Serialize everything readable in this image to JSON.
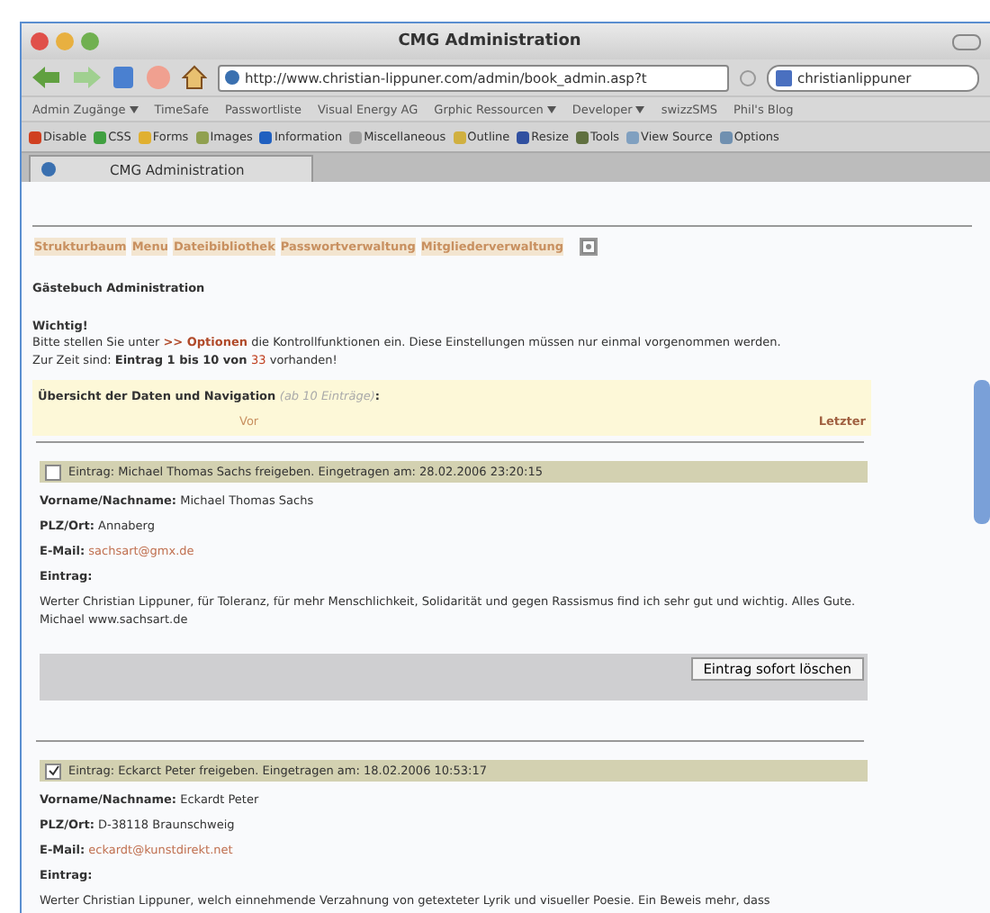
{
  "window": {
    "title": "CMG Administration"
  },
  "toolbar": {
    "url": "http://www.christian-lippuner.com/admin/book_admin.asp?t",
    "search": "christianlippuner"
  },
  "bookmarks": [
    {
      "label": "Admin Zugänge",
      "dropdown": true
    },
    {
      "label": "TimeSafe",
      "dropdown": false
    },
    {
      "label": "Passwortliste",
      "dropdown": false
    },
    {
      "label": "Visual Energy AG",
      "dropdown": false
    },
    {
      "label": "Grphic Ressourcen",
      "dropdown": true
    },
    {
      "label": "Developer",
      "dropdown": true
    },
    {
      "label": "swizzSMS",
      "dropdown": false
    },
    {
      "label": "Phil's Blog",
      "dropdown": false
    }
  ],
  "dev_toolbar": [
    {
      "label": "Disable",
      "color": "#d04020"
    },
    {
      "label": "CSS",
      "color": "#40a040"
    },
    {
      "label": "Forms",
      "color": "#e0b030"
    },
    {
      "label": "Images",
      "color": "#90a050"
    },
    {
      "label": "Information",
      "color": "#2060c0"
    },
    {
      "label": "Miscellaneous",
      "color": "#a0a0a0"
    },
    {
      "label": "Outline",
      "color": "#d0b040"
    },
    {
      "label": "Resize",
      "color": "#3050a0"
    },
    {
      "label": "Tools",
      "color": "#607040"
    },
    {
      "label": "View Source",
      "color": "#80a0c0"
    },
    {
      "label": "Options",
      "color": "#7090b0"
    }
  ],
  "tab": {
    "title": "CMG Administration"
  },
  "nav_links": [
    "Strukturbaum",
    "Menu",
    "Dateibibliothek",
    "Passwortverwaltung",
    "Mitgliederverwaltung"
  ],
  "heading": "Gästebuch Administration",
  "important": "Wichtig!",
  "notice": [
    [
      {
        "kind": "plain",
        "text": "Bitte stellen Sie unter "
      },
      {
        "kind": "link",
        "text": ">> Optionen"
      },
      {
        "kind": "plain",
        "text": " die Kontrollfunktionen ein. Diese Einstellungen müssen nur einmal vorgenommen werden."
      }
    ],
    [
      {
        "kind": "plain",
        "text": "Zur Zeit sind: "
      },
      {
        "kind": "bold",
        "text": "Eintrag 1 bis 10 von "
      },
      {
        "kind": "count",
        "text": "33"
      },
      {
        "kind": "plain",
        "text": " vorhanden!"
      }
    ]
  ],
  "overview": {
    "title": "Übersicht der Daten und Navigation",
    "hint": "(ab 10 Einträge)",
    "colon": ":",
    "prev": "Vor",
    "last": "Letzter"
  },
  "entries": [
    {
      "checked": false,
      "header": "Eintrag: Michael Thomas Sachs freigeben. Eingetragen am: 28.02.2006 23:20:15",
      "fields": [
        {
          "label": "Vorname/Nachname:",
          "value": "Michael Thomas Sachs",
          "kind": "text"
        },
        {
          "label": "PLZ/Ort:",
          "value": "Annaberg",
          "kind": "text"
        },
        {
          "label": "E-Mail:",
          "value": "sachsart@gmx.de",
          "kind": "email"
        }
      ],
      "message_label": "Eintrag:",
      "message": "Werter Christian Lippuner, für Toleranz, für mehr Menschlichkeit, Solidarität und gegen Rassismus find ich sehr gut und wichtig. Alles Gute. Michael www.sachsart.de",
      "delete": "Eintrag sofort löschen"
    },
    {
      "checked": true,
      "header": "Eintrag: Eckarct Peter freigeben. Eingetragen am: 18.02.2006 10:53:17",
      "fields": [
        {
          "label": "Vorname/Nachname:",
          "value": "Eckardt Peter",
          "kind": "text"
        },
        {
          "label": "PLZ/Ort:",
          "value": "D-38118 Braunschweig",
          "kind": "text"
        },
        {
          "label": "E-Mail:",
          "value": "eckardt@kunstdirekt.net",
          "kind": "email"
        }
      ],
      "message_label": "Eintrag:",
      "message": "Werter Christian Lippuner, welch einnehmende Verzahnung von getexteter Lyrik und visueller Poesie. Ein Beweis mehr, dass"
    }
  ]
}
